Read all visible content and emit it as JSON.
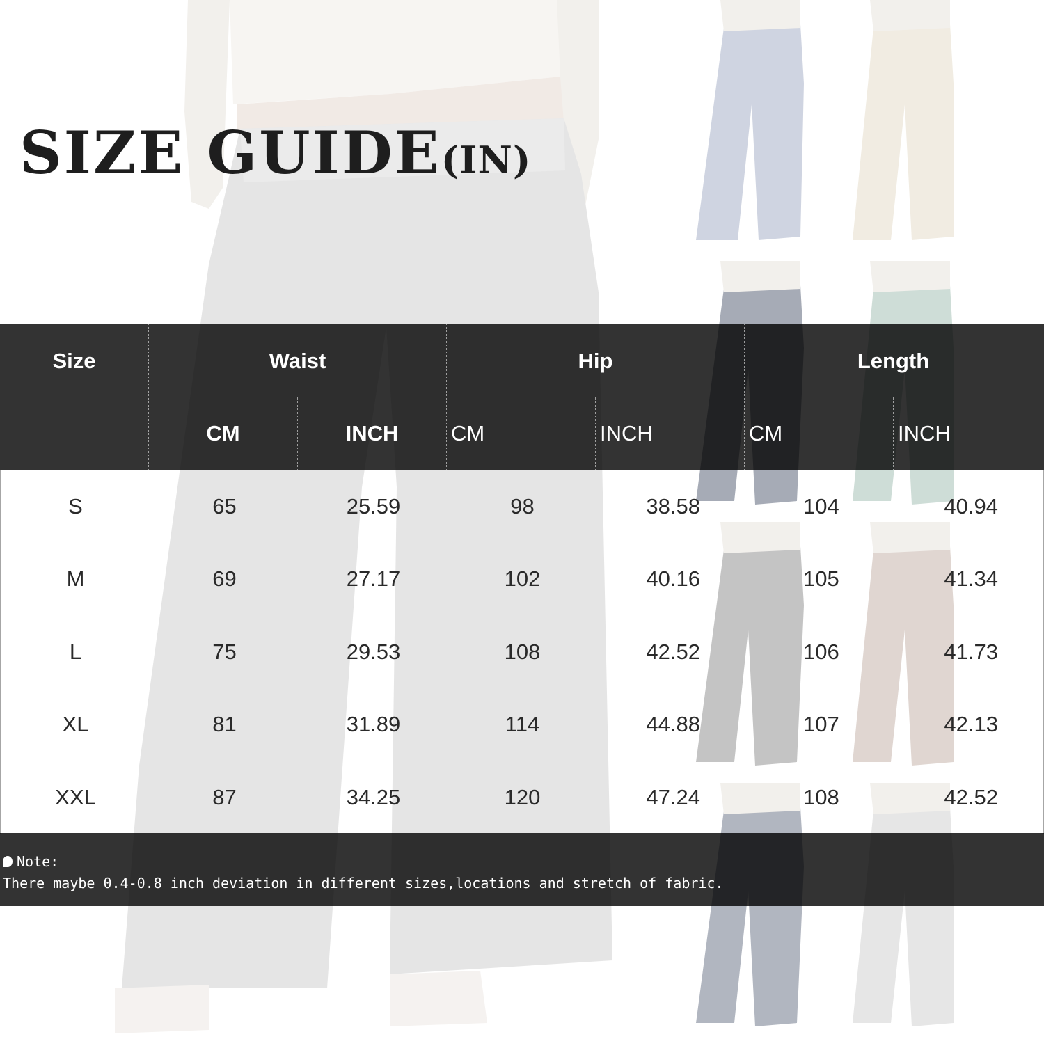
{
  "title": {
    "main": "SIZE GUIDE",
    "unit": "(IN)"
  },
  "table": {
    "headers": {
      "size": "Size",
      "waist": "Waist",
      "hip": "Hip",
      "length": "Length"
    },
    "subheaders": [
      "CM",
      "INCH",
      "CM",
      "INCH",
      "CM",
      "INCH"
    ],
    "rows": [
      [
        "S",
        "65",
        "25.59",
        "98",
        "38.58",
        "104",
        "40.94"
      ],
      [
        "M",
        "69",
        "27.17",
        "102",
        "40.16",
        "105",
        "41.34"
      ],
      [
        "L",
        "75",
        "29.53",
        "108",
        "42.52",
        "106",
        "41.73"
      ],
      [
        "XL",
        "81",
        "31.89",
        "114",
        "44.88",
        "107",
        "42.13"
      ],
      [
        "XXL",
        "87",
        "34.25",
        "120",
        "47.24",
        "108",
        "42.52"
      ]
    ]
  },
  "note": {
    "label": "Note:",
    "text": "There maybe 0.4-0.8 inch deviation in different sizes,locations and stretch of fabric."
  }
}
